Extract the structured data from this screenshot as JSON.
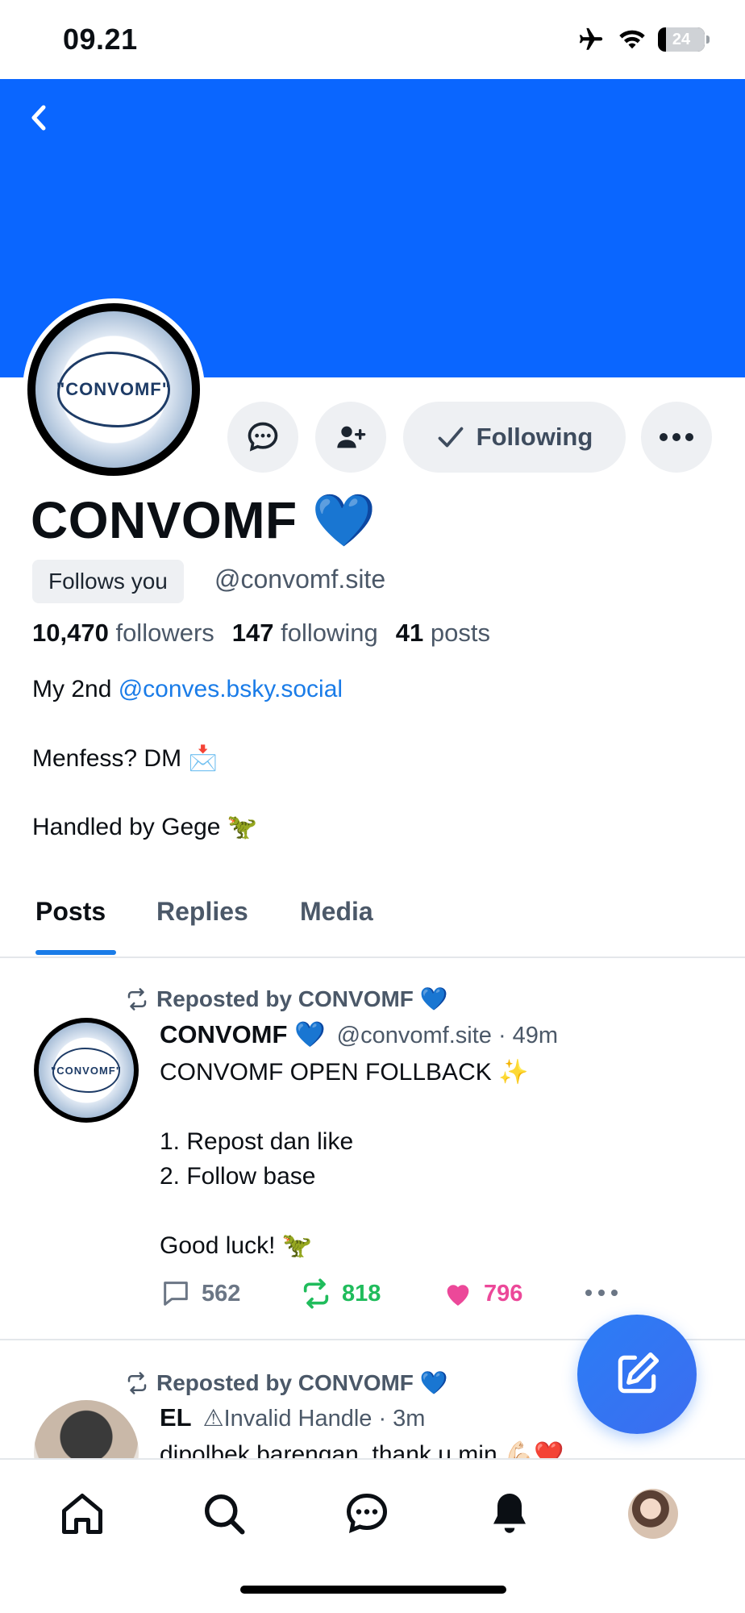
{
  "status_bar": {
    "time": "09.21",
    "battery": "24"
  },
  "colors": {
    "banner": "#0a66ff",
    "link": "#1a7ce8",
    "repost_green": "#20bc5c",
    "like_pink": "#ec4899",
    "fab": "#2b7df5"
  },
  "profile": {
    "avatar_text": "\"CONVOMF\"",
    "display_name": "CONVOMF 💙",
    "follows_you": "Follows you",
    "handle": "@convomf.site",
    "following_label": "Following",
    "stats": {
      "followers_count": "10,470",
      "followers_label": "followers",
      "following_count": "147",
      "following_label": "following",
      "posts_count": "41",
      "posts_label": "posts"
    },
    "bio": {
      "line1_prefix": "My 2nd ",
      "line1_link": "@conves.bsky.social",
      "line2": "Menfess? DM 📩",
      "line3": "Handled by Gege 🦖"
    }
  },
  "tabs": [
    {
      "label": "Posts",
      "active": true
    },
    {
      "label": "Replies"
    },
    {
      "label": "Media"
    }
  ],
  "feed": [
    {
      "repost_label": "Reposted by CONVOMF 💙",
      "author_name": "CONVOMF 💙",
      "author_meta": "@convomf.site · 49m",
      "avatar_text": "\"CONVOMF\"",
      "text": "CONVOMF OPEN FOLLBACK ✨\n\n1. Repost dan like\n2. Follow base\n\nGood luck! 🦖",
      "replies": "562",
      "reposts": "818",
      "likes": "796"
    },
    {
      "repost_label": "Reposted by CONVOMF 💙",
      "author_name": "EL",
      "author_meta": "⚠Invalid Handle · 3m",
      "text": "dipolbek barengan, thank u min 💪🏻❤️"
    }
  ],
  "icons": [
    "back-icon",
    "chat-icon",
    "person-add-icon",
    "check-icon",
    "more-icon",
    "repost-icon",
    "reply-icon",
    "like-icon",
    "compose-icon",
    "home-icon",
    "search-icon",
    "messages-icon",
    "bell-icon",
    "profile-avatar-icon",
    "airplane-icon",
    "wifi-icon",
    "battery-icon"
  ]
}
